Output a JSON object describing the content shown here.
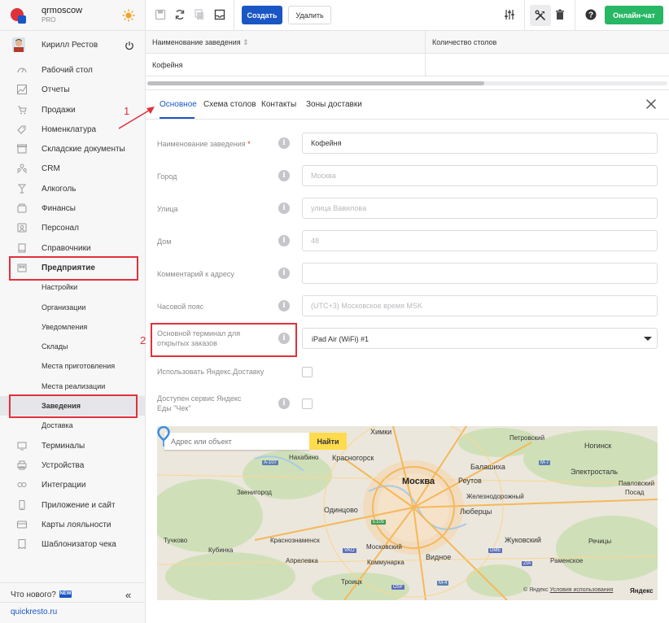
{
  "brand": {
    "name": "qrmoscow",
    "plan": "PRO"
  },
  "user": {
    "name": "Кирилл Рестов"
  },
  "nav": [
    {
      "label": "Рабочий стол",
      "icon": "dashboard-icon"
    },
    {
      "label": "Отчеты",
      "icon": "chart-icon"
    },
    {
      "label": "Продажи",
      "icon": "cart-icon"
    },
    {
      "label": "Номенклатура",
      "icon": "tag-icon"
    },
    {
      "label": "Складские документы",
      "icon": "box-icon"
    },
    {
      "label": "CRM",
      "icon": "people-icon"
    },
    {
      "label": "Алкоголь",
      "icon": "glass-icon"
    },
    {
      "label": "Финансы",
      "icon": "wallet-icon"
    },
    {
      "label": "Персонал",
      "icon": "person-icon"
    },
    {
      "label": "Справочники",
      "icon": "book-icon"
    },
    {
      "label": "Предприятие",
      "icon": "building-icon"
    },
    {
      "label": "Настройки",
      "icon": ""
    },
    {
      "label": "Организации",
      "icon": ""
    },
    {
      "label": "Уведомления",
      "icon": ""
    },
    {
      "label": "Склады",
      "icon": ""
    },
    {
      "label": "Места приготовления",
      "icon": ""
    },
    {
      "label": "Места реализации",
      "icon": ""
    },
    {
      "label": "Заведения",
      "icon": ""
    },
    {
      "label": "Доставка",
      "icon": ""
    },
    {
      "label": "Терминалы",
      "icon": "terminal-icon"
    },
    {
      "label": "Устройства",
      "icon": "printer-icon"
    },
    {
      "label": "Интеграции",
      "icon": "link-icon"
    },
    {
      "label": "Приложение и сайт",
      "icon": "phone-icon"
    },
    {
      "label": "Карты лояльности",
      "icon": "card-icon"
    },
    {
      "label": "Шаблонизатор чека",
      "icon": "receipt-icon"
    }
  ],
  "footer": {
    "whats_new": "Что нового?",
    "new_badge": "NEW",
    "site": "quickresto.ru"
  },
  "toolbar": {
    "create": "Создать",
    "delete": "Удалить",
    "chat": "Онлайн-чат"
  },
  "table": {
    "headers": [
      "Наименование заведения",
      "Количество столов"
    ],
    "rows": [
      [
        "Кофейня",
        ""
      ]
    ]
  },
  "tabs": [
    "Основное",
    "Схема столов",
    "Контакты",
    "Зоны доставки"
  ],
  "form": {
    "name": {
      "label": "Наименование заведения",
      "required": "*",
      "value": "Кофейня"
    },
    "city": {
      "label": "Город",
      "placeholder": "Москва"
    },
    "street": {
      "label": "Улица",
      "placeholder": "улица Вавилова"
    },
    "house": {
      "label": "Дом",
      "placeholder": "48"
    },
    "comment": {
      "label": "Комментарий к адресу",
      "placeholder": ""
    },
    "timezone": {
      "label": "Часовой пояс",
      "placeholder": "(UTC+3) Московское время MSK"
    },
    "terminal": {
      "label_line1": "Основной терминал для",
      "label_line2": "открытых заказов",
      "value": "iPad Air (WiFi) #1"
    },
    "yandex_delivery": {
      "label": "Использовать Яндекс.Доставку"
    },
    "yandex_eda_line1": "Доступен сервис Яндекс",
    "yandex_eda_line2": "Еды \"Чек\""
  },
  "map": {
    "search_placeholder": "Адрес или объект",
    "find": "Найти",
    "labels": {
      "himki": "Химки",
      "petrovsky": "Петровский",
      "nakhabino": "Нахабино",
      "krasnogorsk": "Красногорск",
      "moscow": "Москва",
      "reutov": "Реутов",
      "balashikha": "Балашиха",
      "noginsk": "Ногинск",
      "elektrostal": "Электросталь",
      "zvenigorod": "Звенигород",
      "zheleznodorozhny": "Железнодорожный",
      "odintsovo": "Одинцово",
      "lyubertsy": "Люберцы",
      "pavlovsky": "Павловский",
      "posad": "Посад",
      "ramenskoe": "Раменское",
      "zhukovsky": "Жуковский",
      "tuchkovo": "Тучково",
      "kubinka": "Кубинка",
      "krasnoznamensk": "Краснознаменск",
      "moskovsky": "Московский",
      "aprelevka": "Апрелевка",
      "kommunarka": "Коммунарка",
      "vidnoe": "Видное",
      "troitsk": "Троицк",
      "rechitsy": "Речицы"
    },
    "roads": [
      "A-107",
      "M-7",
      "E105",
      "M-4"
    ],
    "airports": [
      "VKO",
      "DME",
      "OSF",
      "ZIA"
    ],
    "copyright": "© Яндекс",
    "terms": "Условия использования",
    "brand": "Яндекс"
  },
  "annotations": [
    "1",
    "2"
  ],
  "colors": {
    "accent": "#1a56c4",
    "chat": "#27b765",
    "highlight": "#e0313b",
    "map_button": "#ffdb4d"
  }
}
